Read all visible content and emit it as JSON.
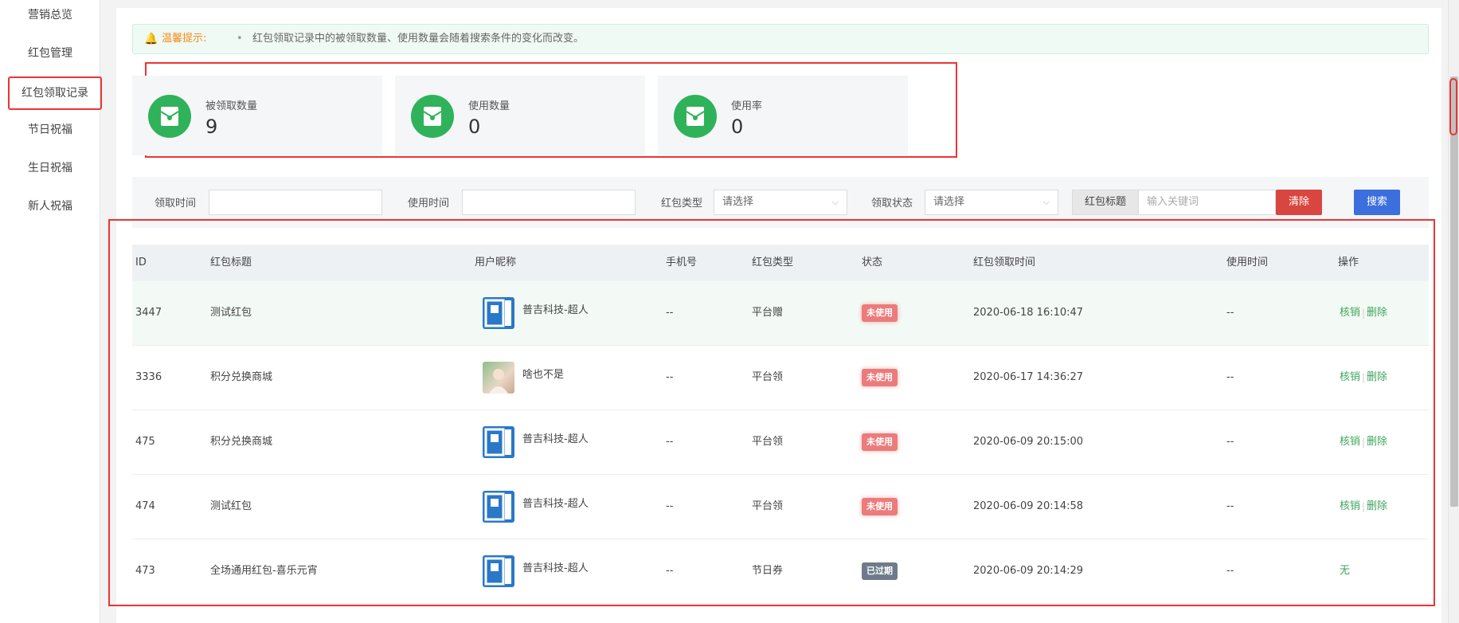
{
  "sidebar": {
    "items": [
      {
        "label": "营销总览"
      },
      {
        "label": "红包管理"
      },
      {
        "label": "红包领取记录"
      },
      {
        "label": "节日祝福"
      },
      {
        "label": "生日祝福"
      },
      {
        "label": "新人祝福"
      }
    ],
    "active_index": 2
  },
  "tip": {
    "label": "温馨提示:",
    "bullet": "•",
    "text": "红包领取记录中的被领取数量、使用数量会随着搜索条件的变化而改变。"
  },
  "stats": [
    {
      "label": "被领取数量",
      "value": "9",
      "icon": "red-envelope-icon"
    },
    {
      "label": "使用数量",
      "value": "0",
      "icon": "red-envelope-icon"
    },
    {
      "label": "使用率",
      "value": "0",
      "icon": "red-envelope-icon"
    }
  ],
  "filters": {
    "receive_time_label": "领取时间",
    "use_time_label": "使用时间",
    "type_label": "红包类型",
    "type_placeholder": "请选择",
    "status_label": "领取状态",
    "status_placeholder": "请选择",
    "keyword_label": "红包标题",
    "keyword_placeholder": "输入关键词",
    "clear_label": "清除",
    "search_label": "搜索"
  },
  "table": {
    "headers": [
      "ID",
      "红包标题",
      "用户昵称",
      "手机号",
      "红包类型",
      "状态",
      "红包领取时间",
      "使用时间",
      "操作"
    ],
    "rows": [
      {
        "id": "3447",
        "title": "测试红包",
        "nickname": "普吉科技-超人",
        "avatar": "logo",
        "phone": "--",
        "type": "平台赠",
        "status": "未使用",
        "status_kind": "unused",
        "received": "2020-06-18 16:10:47",
        "used": "--",
        "ops": [
          "核销",
          "删除"
        ]
      },
      {
        "id": "3336",
        "title": "积分兑换商城",
        "nickname": "啥也不是",
        "avatar": "photo",
        "phone": "--",
        "type": "平台领",
        "status": "未使用",
        "status_kind": "unused",
        "received": "2020-06-17 14:36:27",
        "used": "--",
        "ops": [
          "核销",
          "删除"
        ]
      },
      {
        "id": "475",
        "title": "积分兑换商城",
        "nickname": "普吉科技-超人",
        "avatar": "logo",
        "phone": "--",
        "type": "平台领",
        "status": "未使用",
        "status_kind": "unused",
        "received": "2020-06-09 20:15:00",
        "used": "--",
        "ops": [
          "核销",
          "删除"
        ]
      },
      {
        "id": "474",
        "title": "测试红包",
        "nickname": "普吉科技-超人",
        "avatar": "logo",
        "phone": "--",
        "type": "平台领",
        "status": "未使用",
        "status_kind": "unused",
        "received": "2020-06-09 20:14:58",
        "used": "--",
        "ops": [
          "核销",
          "删除"
        ]
      },
      {
        "id": "473",
        "title": "全场通用红包-喜乐元宵",
        "nickname": "普吉科技-超人",
        "avatar": "logo",
        "phone": "--",
        "type": "节日券",
        "status": "已过期",
        "status_kind": "expired",
        "received": "2020-06-09 20:14:29",
        "used": "--",
        "ops": [
          "无"
        ]
      }
    ]
  },
  "colors": {
    "accent_green": "#2fb25a",
    "danger": "#d9463f",
    "primary": "#3c6fdd",
    "annotation_red": "#e33"
  }
}
